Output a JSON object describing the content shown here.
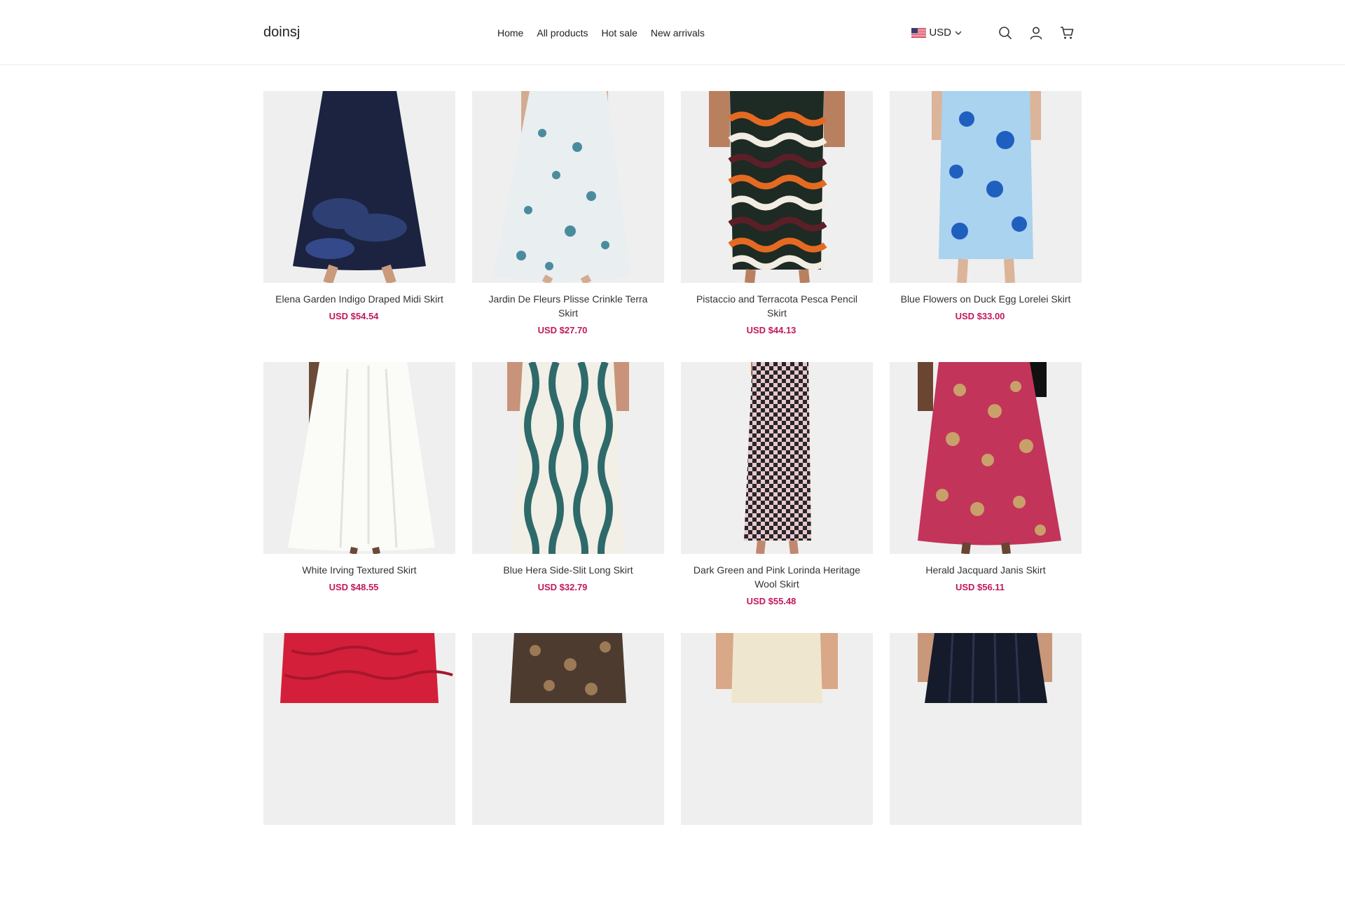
{
  "store": {
    "name": "doinsj"
  },
  "nav": [
    {
      "label": "Home"
    },
    {
      "label": "All products"
    },
    {
      "label": "Hot sale"
    },
    {
      "label": "New arrivals"
    }
  ],
  "currency": {
    "code": "USD",
    "flag_icon": "us-flag-icon"
  },
  "header_icons": [
    "search-icon",
    "account-icon",
    "cart-icon"
  ],
  "colors": {
    "price": "#c2185b",
    "image_bg": "#efefef",
    "border": "#ececec"
  },
  "products": [
    {
      "name": "Elena Garden Indigo Draped Midi Skirt",
      "price": "USD $54.54"
    },
    {
      "name": "Jardin De Fleurs Plisse Crinkle Terra Skirt",
      "price": "USD $27.70"
    },
    {
      "name": "Pistaccio and Terracota Pesca Pencil Skirt",
      "price": "USD $44.13"
    },
    {
      "name": "Blue Flowers on Duck Egg Lorelei Skirt",
      "price": "USD $33.00"
    },
    {
      "name": "White Irving Textured Skirt",
      "price": "USD $48.55"
    },
    {
      "name": "Blue Hera Side-Slit Long Skirt",
      "price": "USD $32.79"
    },
    {
      "name": "Dark Green and Pink Lorinda Heritage Wool Skirt",
      "price": "USD $55.48"
    },
    {
      "name": "Herald Jacquard Janis Skirt",
      "price": "USD $56.11"
    },
    {
      "name": "",
      "price": ""
    },
    {
      "name": "",
      "price": ""
    },
    {
      "name": "",
      "price": ""
    },
    {
      "name": "",
      "price": ""
    }
  ]
}
